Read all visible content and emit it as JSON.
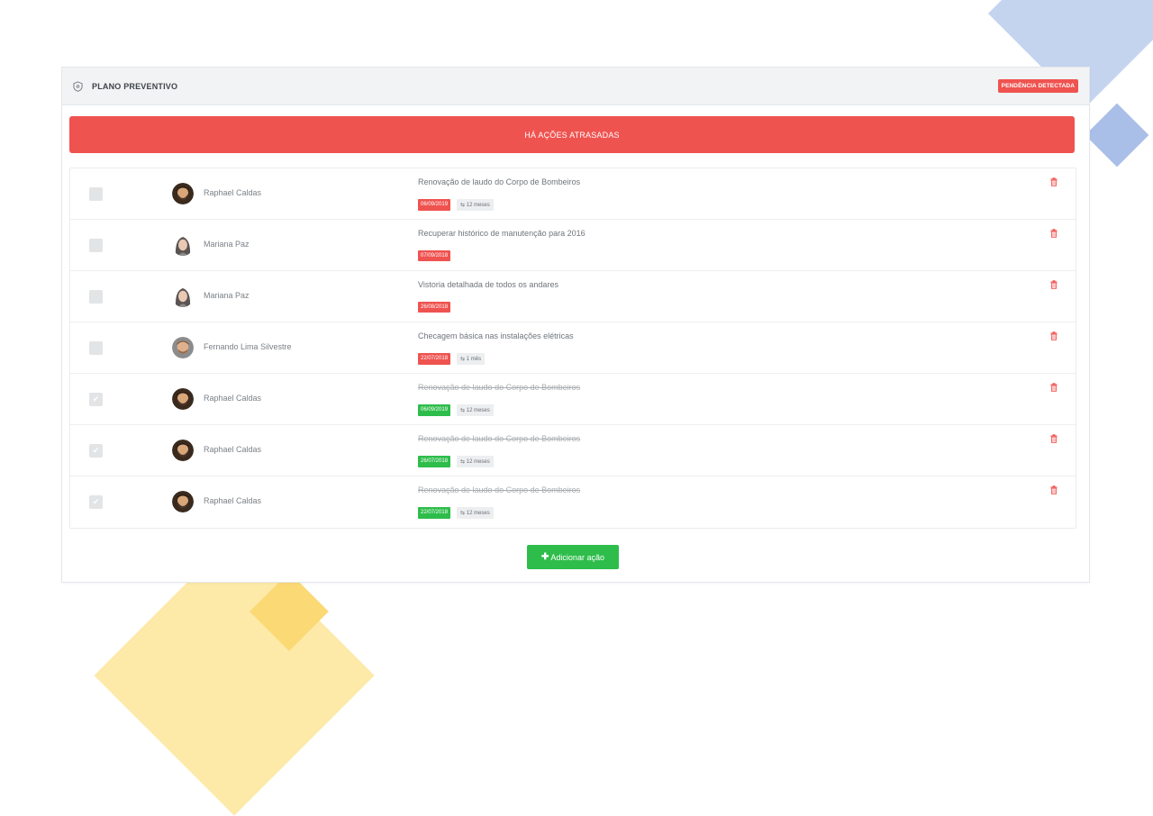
{
  "header": {
    "title": "PLANO PREVENTIVO",
    "badge": "PENDÊNCIA DETECTADA"
  },
  "alert": {
    "text": "HÁ AÇÕES ATRASADAS"
  },
  "colors": {
    "danger": "#ef5350",
    "success": "#2ebd4b",
    "header_bg": "#f1f3f4"
  },
  "actions": [
    {
      "person": "Raphael Caldas",
      "avatar": "man-beard-avatar",
      "task": "Renovação de laudo do Corpo de Bombeiros",
      "date": "06/09/2019",
      "date_status": "overdue",
      "recurrence": "12 meses",
      "done": false
    },
    {
      "person": "Mariana Paz",
      "avatar": "woman-avatar",
      "task": "Recuperar histórico de manutenção para 2016",
      "date": "07/09/2018",
      "date_status": "overdue",
      "recurrence": "",
      "done": false
    },
    {
      "person": "Mariana Paz",
      "avatar": "woman-avatar",
      "task": "Vistoria detalhada de todos os andares",
      "date": "26/08/2018",
      "date_status": "overdue",
      "recurrence": "",
      "done": false
    },
    {
      "person": "Fernando Lima Silvestre",
      "avatar": "man-avatar",
      "task": "Checagem básica nas instalações elétricas",
      "date": "22/07/2018",
      "date_status": "overdue",
      "recurrence": "1 mês",
      "done": false
    },
    {
      "person": "Raphael Caldas",
      "avatar": "man-beard-avatar",
      "task": "Renovação de laudo do Corpo de Bombeiros",
      "date": "06/09/2019",
      "date_status": "done",
      "recurrence": "12 meses",
      "done": true
    },
    {
      "person": "Raphael Caldas",
      "avatar": "man-beard-avatar",
      "task": "Renovação de laudo do Corpo de Bombeiros",
      "date": "26/07/2018",
      "date_status": "done",
      "recurrence": "12 meses",
      "done": true
    },
    {
      "person": "Raphael Caldas",
      "avatar": "man-beard-avatar",
      "task": "Renovação de laudo do Corpo de Bombeiros",
      "date": "22/07/2018",
      "date_status": "done",
      "recurrence": "12 meses",
      "done": true
    }
  ],
  "add_button": {
    "label": "Adicionar ação"
  }
}
